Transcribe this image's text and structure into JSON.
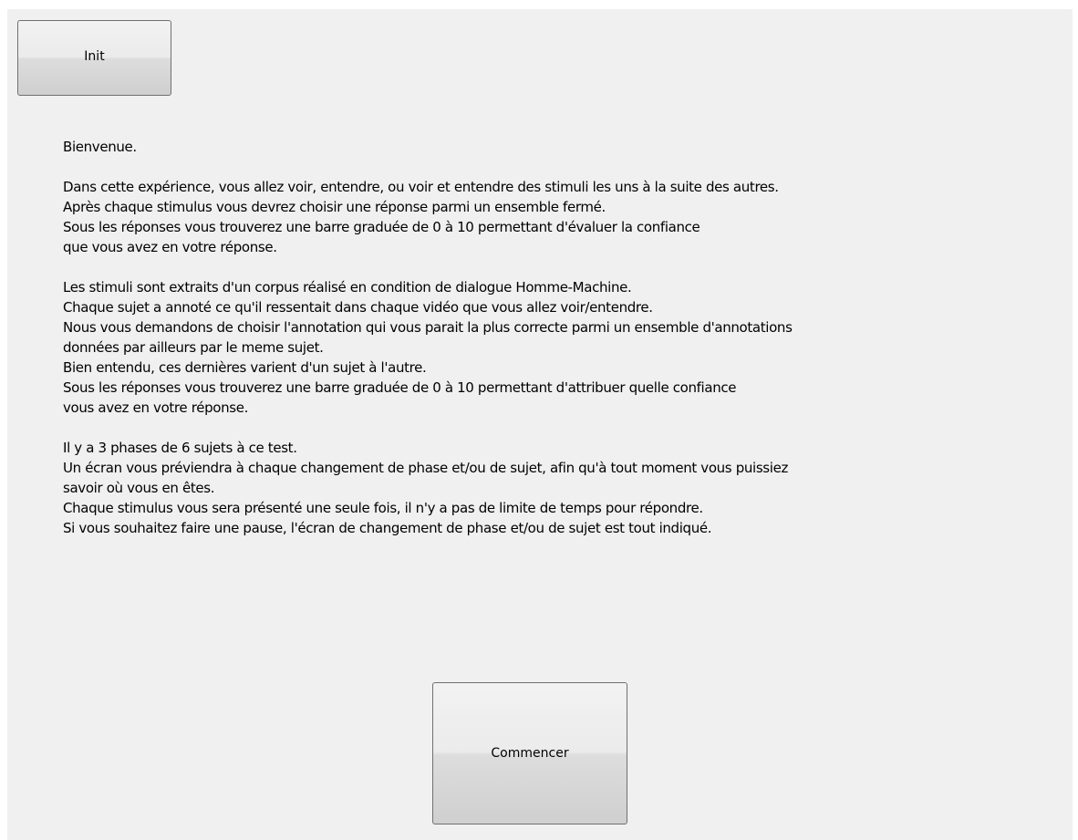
{
  "buttons": {
    "init_label": "Init",
    "start_label": "Commencer"
  },
  "instructions": {
    "paragraphs": [
      {
        "lines": [
          "Bienvenue."
        ]
      },
      {
        "lines": [
          "Dans cette expérience, vous allez voir, entendre, ou voir et entendre des stimuli les uns à la suite des autres.",
          "Après chaque stimulus vous devrez choisir une réponse parmi un ensemble fermé.",
          "Sous les réponses vous trouverez une barre graduée de 0 à 10 permettant d'évaluer la confiance",
          "que vous avez en votre réponse."
        ]
      },
      {
        "lines": [
          "Les stimuli sont extraits d'un corpus réalisé en condition de dialogue Homme-Machine.",
          "Chaque sujet a annoté ce qu'il ressentait dans chaque vidéo que vous allez voir/entendre.",
          "Nous vous demandons de choisir l'annotation qui vous parait la plus correcte parmi un ensemble d'annotations",
          "données par ailleurs par le meme sujet.",
          "Bien entendu, ces dernières varient d'un sujet à l'autre.",
          "Sous les réponses vous trouverez une barre graduée de 0 à 10 permettant d'attribuer quelle confiance",
          "vous avez en votre réponse."
        ]
      },
      {
        "lines": [
          "Il y a 3 phases de 6 sujets à ce test.",
          "Un écran vous préviendra à chaque changement de phase et/ou de sujet, afin qu'à tout moment vous puissiez",
          "savoir où vous en êtes.",
          "Chaque stimulus vous sera présenté une seule fois, il n'y a pas de limite de temps pour répondre.",
          "Si vous souhaitez faire une pause, l'écran de changement de phase et/ou de sujet est tout indiqué."
        ]
      }
    ]
  }
}
